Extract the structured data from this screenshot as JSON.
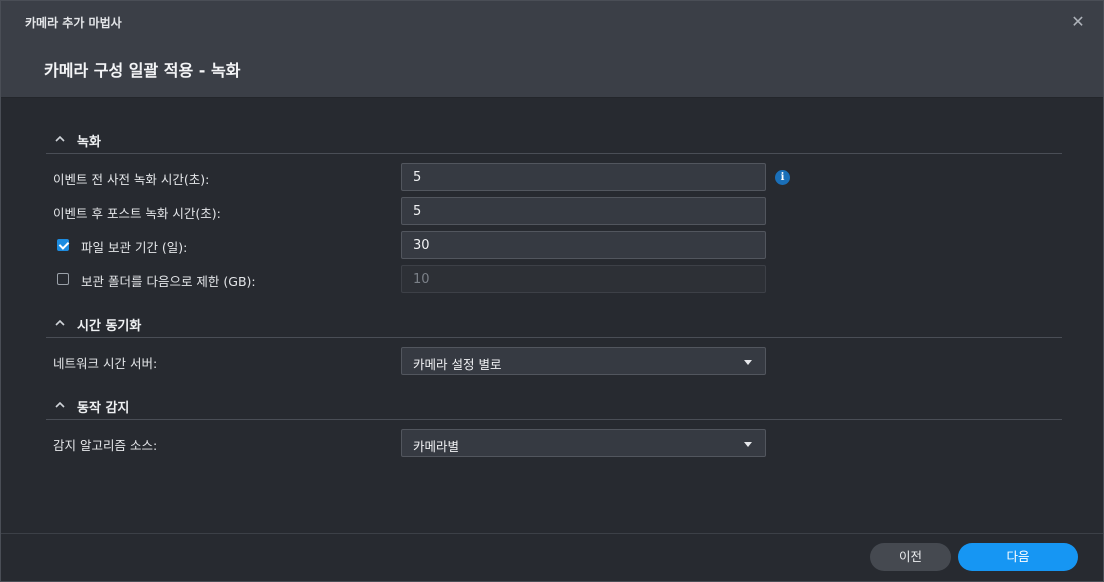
{
  "window": {
    "title": "카메라 추가 마법사",
    "close": "✕"
  },
  "page": {
    "title": "카메라 구성 일괄 적용 - 녹화"
  },
  "sections": {
    "recording": {
      "title": "녹화",
      "pre_event": {
        "label": "이벤트 전 사전 녹화 시간(초):",
        "value": "5",
        "info": "i"
      },
      "post_event": {
        "label": "이벤트 후 포스트 녹화 시간(초):",
        "value": "5"
      },
      "retention": {
        "label": "파일 보관 기간 (일):",
        "value": "30",
        "checked": true
      },
      "folder_limit": {
        "label": "보관 폴더를 다음으로 제한 (GB):",
        "value": "10",
        "checked": false
      }
    },
    "time_sync": {
      "title": "시간 동기화",
      "ntp": {
        "label": "네트워크 시간 서버:",
        "value": "카메라 설정 별로"
      }
    },
    "motion": {
      "title": "동작 감지",
      "algorithm": {
        "label": "감지 알고리즘 소스:",
        "value": "카메라별"
      }
    }
  },
  "footer": {
    "prev_label": "이전",
    "next_label": "다음"
  },
  "colors": {
    "accent": "#1696f3",
    "header_bg": "#3b3f47",
    "body_bg": "#272a30"
  }
}
